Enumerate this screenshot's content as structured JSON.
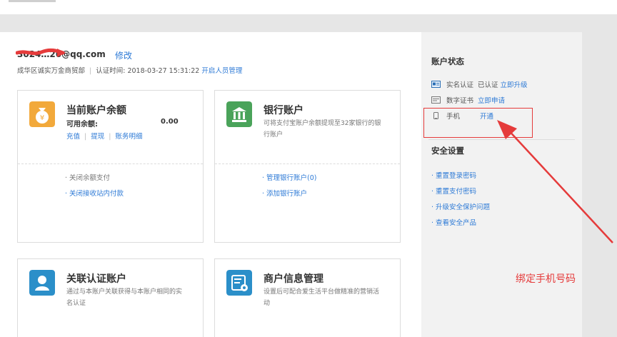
{
  "account": {
    "email": "3024…26@qq.com",
    "edit_label": "修改",
    "location": "成华区诚实万金商贸部",
    "auth_time_label": "认证时间:",
    "auth_time": "2018-03-27 15:31:22",
    "member_link": "开启人员管理"
  },
  "cards": {
    "balance": {
      "title": "当前账户余额",
      "balance_label": "可用余额:",
      "balance_value": "0.00",
      "links": [
        "充值",
        "提现",
        "账务明细"
      ],
      "bullets": [
        "关闭余额支付",
        "关闭接收站内付款"
      ]
    },
    "bank": {
      "title": "银行账户",
      "desc": "可将支付宝账户余额提现至32家银行的银行账户",
      "bullets": [
        "管理银行账户(0)",
        "添加银行账户"
      ]
    },
    "auth": {
      "title": "关联认证账户",
      "desc": "通过与本账户关联获得与本账户相同的实名认证"
    },
    "merchant": {
      "title": "商户信息管理",
      "desc": "设置后可配合爱生活平台做精准的营销活动"
    }
  },
  "sidebar": {
    "status_title": "账户状态",
    "status_items": [
      {
        "label": "实名认证",
        "state": "已认证",
        "action": "立即升级"
      },
      {
        "label": "数字证书",
        "state": "",
        "action": "立即申请"
      },
      {
        "label": "手机",
        "state": "",
        "action": "开通"
      }
    ],
    "security_title": "安全设置",
    "security_links": [
      "重置登录密码",
      "重置支付密码",
      "升级安全保护问题",
      "查看安全产品"
    ]
  },
  "annotation": {
    "text": "绑定手机号码"
  },
  "colors": {
    "link": "#2d7ad6",
    "annotation": "#e53b3b",
    "balance_icon": "#f2a93b",
    "bank_icon": "#4aa35a",
    "auth_icon": "#2b8fc9",
    "merchant_icon": "#2b8fc9"
  }
}
